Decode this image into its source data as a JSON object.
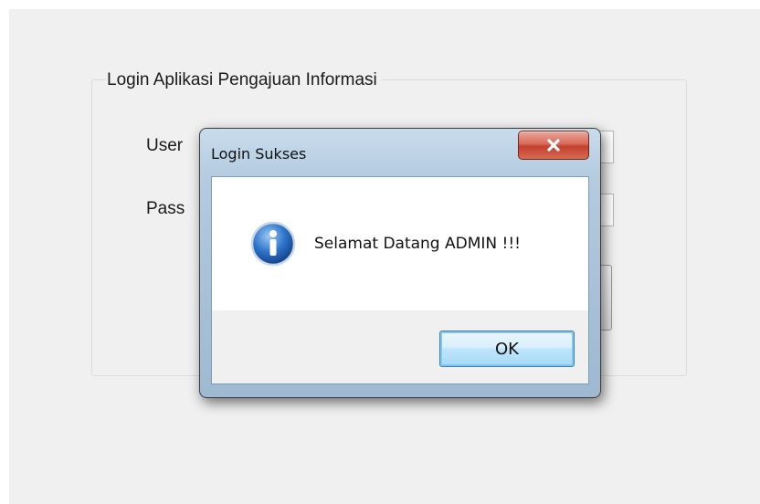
{
  "main_form": {
    "group_title": "Login Aplikasi Pengajuan Informasi",
    "username_label": "User",
    "password_label": "Pass"
  },
  "dialog": {
    "title": "Login Sukses",
    "message": "Selamat Datang ADMIN !!!",
    "ok_label": "OK",
    "icon": "info-icon",
    "close_icon": "close-icon"
  },
  "colors": {
    "close_button": "#c3402f",
    "ok_button_border": "#3c7fb1",
    "info_icon": "#1f5fb5"
  }
}
